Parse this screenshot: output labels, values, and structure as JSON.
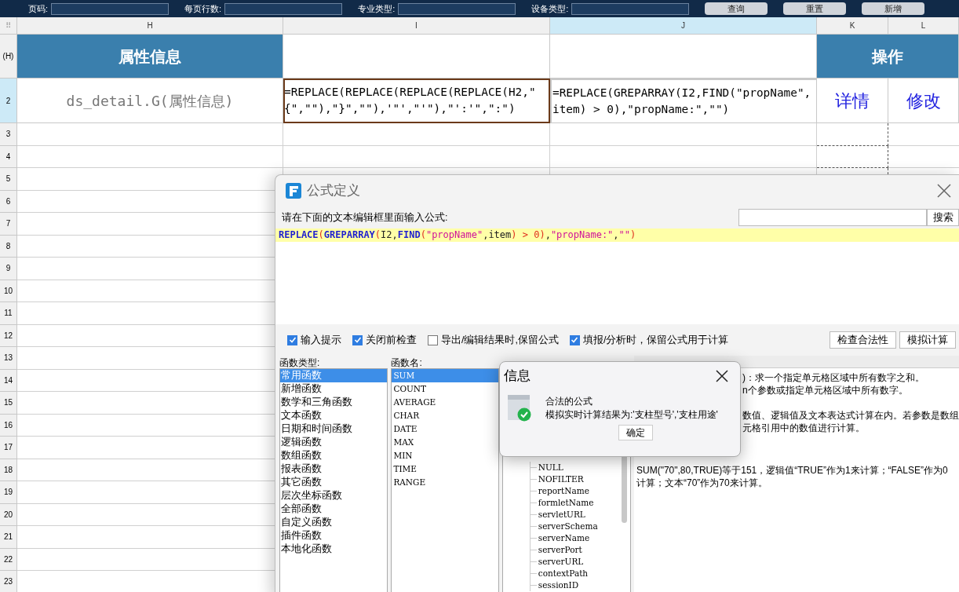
{
  "toolbar": {
    "fields": [
      {
        "label": "页码:"
      },
      {
        "label": "每页行数:"
      },
      {
        "label": "专业类型:"
      },
      {
        "label": "设备类型:"
      }
    ],
    "buttons": [
      "查询",
      "重置",
      "新增"
    ]
  },
  "sheet": {
    "corner": "⠿",
    "columns": [
      {
        "label": "H",
        "selected": false
      },
      {
        "label": "I",
        "selected": false
      },
      {
        "label": "J",
        "selected": true
      },
      {
        "label": "K",
        "selected": false
      },
      {
        "label": "L",
        "selected": false
      }
    ],
    "header_row": {
      "label": "(H)",
      "cells": [
        {
          "kind": "header",
          "text": "属性信息"
        },
        {
          "kind": "blank"
        },
        {
          "kind": "blank"
        },
        {
          "kind": "merged_header",
          "text": "操作"
        }
      ]
    },
    "data_row": {
      "label": "2",
      "cells": [
        {
          "kind": "field",
          "text": "ds_detail.G(属性信息)"
        },
        {
          "kind": "formula",
          "selected": false,
          "copied": true,
          "text": "=REPLACE(REPLACE(REPLACE(REPLACE(H2,\"{\",\"\"),\"}\",\"\"),'\"',\"'\"),\"':'\",\":\")"
        },
        {
          "kind": "formula",
          "selected": true,
          "copied": false,
          "text": "=REPLACE(GREPARRAY(I2,FIND(\"propName\",item) > 0),\"propName:\",\"\")"
        },
        {
          "kind": "link",
          "text": "详情"
        },
        {
          "kind": "link",
          "text": "修改"
        }
      ]
    },
    "empty_rows": [
      "3",
      "4",
      "5",
      "6",
      "7",
      "8",
      "9",
      "10",
      "11",
      "12",
      "13",
      "14",
      "15",
      "16",
      "17",
      "18",
      "19",
      "20",
      "21",
      "22",
      "23"
    ]
  },
  "dialog": {
    "title": "公式定义",
    "prompt": "请在下面的文本编辑框里面输入公式:",
    "search_button": "搜索",
    "formula": [
      {
        "kind": "function",
        "text": "REPLACE"
      },
      {
        "kind": "paren",
        "text": "("
      },
      {
        "kind": "function",
        "text": "GREPARRAY"
      },
      {
        "kind": "paren",
        "text": "("
      },
      {
        "kind": "plain",
        "text": "I2,"
      },
      {
        "kind": "function",
        "text": "FIND"
      },
      {
        "kind": "paren",
        "text": "("
      },
      {
        "kind": "string",
        "text": "\"propName\""
      },
      {
        "kind": "plain",
        "text": ",item"
      },
      {
        "kind": "paren",
        "text": ") > 0"
      },
      {
        "kind": "paren",
        "text": ")"
      },
      {
        "kind": "plain",
        "text": ","
      },
      {
        "kind": "string",
        "text": "\"propName:\""
      },
      {
        "kind": "plain",
        "text": ","
      },
      {
        "kind": "string",
        "text": "\"\""
      },
      {
        "kind": "paren",
        "text": ")"
      }
    ],
    "options": [
      {
        "label": "输入提示",
        "checked": true
      },
      {
        "label": "关闭前检查",
        "checked": true
      },
      {
        "label": "导出/编辑结果时,保留公式",
        "checked": false
      },
      {
        "label": "填报/分析时，保留公式用于计算",
        "checked": true
      }
    ],
    "action_buttons": [
      "检查合法性",
      "模拟计算"
    ],
    "type_list": {
      "label": "函数类型:",
      "items": [
        {
          "text": "常用函数",
          "selected": true
        },
        {
          "text": "新增函数",
          "selected": false
        },
        {
          "text": "数学和三角函数",
          "selected": false
        },
        {
          "text": "文本函数",
          "selected": false
        },
        {
          "text": "日期和时间函数",
          "selected": false
        },
        {
          "text": "逻辑函数",
          "selected": false
        },
        {
          "text": "数组函数",
          "selected": false
        },
        {
          "text": "报表函数",
          "selected": false
        },
        {
          "text": "其它函数",
          "selected": false
        },
        {
          "text": "层次坐标函数",
          "selected": false
        },
        {
          "text": "全部函数",
          "selected": false
        },
        {
          "text": "自定义函数",
          "selected": false
        },
        {
          "text": "插件函数",
          "selected": false
        },
        {
          "text": "本地化函数",
          "selected": false
        }
      ]
    },
    "name_list": {
      "label": "函数名:",
      "items": [
        {
          "text": "SUM",
          "selected": true
        },
        {
          "text": "COUNT",
          "selected": false
        },
        {
          "text": "AVERAGE",
          "selected": false
        },
        {
          "text": "CHAR",
          "selected": false
        },
        {
          "text": "DATE",
          "selected": false
        },
        {
          "text": "MAX",
          "selected": false
        },
        {
          "text": "MIN",
          "selected": false
        },
        {
          "text": "TIME",
          "selected": false
        },
        {
          "text": "RANGE",
          "selected": false
        }
      ]
    },
    "variables": [
      "NULL",
      "NOFILTER",
      "reportName",
      "formletName",
      "servletURL",
      "serverSchema",
      "serverName",
      "serverPort",
      "serverURL",
      "contextPath",
      "sessionID"
    ],
    "description": [
      {
        "kind": "covered",
        "lines": [
          ")：求一个指定单元格区域中所有数字之和。",
          "n个参数或指定单元格区域中所有数字。"
        ]
      },
      {
        "kind": "covered",
        "lines": [
          "数值、逻辑值及文本表达式计算在内。若参数是数组",
          "元格引用中的数值进行计算。"
        ]
      },
      {
        "kind": "full",
        "lines": [
          "SUM(\"70\",80,TRUE)等于151，逻辑值“TRUE”作为1来计算；“FALSE”作为0",
          "计算；文本“70”作为70来计算。"
        ]
      }
    ]
  },
  "message": {
    "title": "信息",
    "heading": "合法的公式",
    "text": "模拟实时计算结果为:'支柱型号','支柱用途'",
    "button": "确定"
  }
}
